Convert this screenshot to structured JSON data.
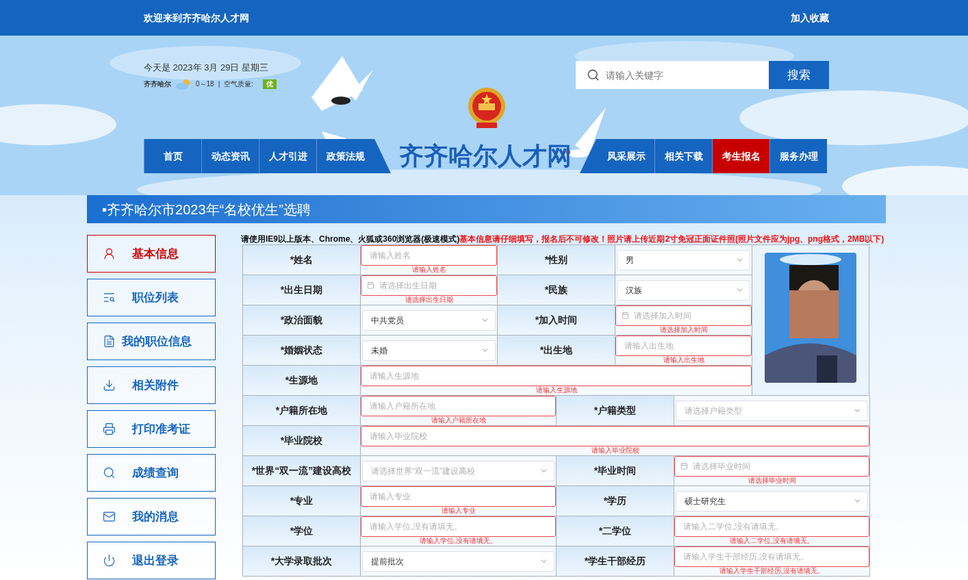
{
  "top_bar": {
    "welcome": "欢迎来到齐齐哈尔人才网",
    "favorite": "加入收藏"
  },
  "header": {
    "date": "今天是 2023年 3月 29日 星期三",
    "weather": {
      "city": "齐齐哈尔",
      "temperature": "0～18",
      "separator": "|",
      "air_quality_label": "空气质量:",
      "air_quality": "优"
    },
    "search": {
      "placeholder": "请输入关键字",
      "button": "搜索"
    },
    "site_title": "齐齐哈尔人才网",
    "nav_left": [
      {
        "label": "首页",
        "selected": false
      },
      {
        "label": "动态资讯",
        "selected": false
      },
      {
        "label": "人才引进",
        "selected": false
      },
      {
        "label": "政策法规",
        "selected": false
      }
    ],
    "nav_right": [
      {
        "label": "风采展示",
        "selected": false
      },
      {
        "label": "相关下载",
        "selected": false
      },
      {
        "label": "考生报名",
        "selected": true
      },
      {
        "label": "服务办理",
        "selected": false
      }
    ]
  },
  "banner": {
    "title": "▪齐齐哈尔市2023年“名校优生”选聘"
  },
  "notice": {
    "general": "请使用IE9以上版本、Chrome、火狐或360浏览器(极速模式)",
    "warning": "基本信息请仔细填写，报名后不可修改！照片请上传近期2寸免冠正面证件照(照片文件应为jpg、png格式，2MB以下)"
  },
  "sidebar": [
    {
      "label": "基本信息",
      "selected": true
    },
    {
      "label": "职位列表",
      "selected": false
    },
    {
      "label": "我的职位信息",
      "selected": false
    },
    {
      "label": "相关附件",
      "selected": false
    },
    {
      "label": "打印准考证",
      "selected": false
    },
    {
      "label": "成绩查询",
      "selected": false
    },
    {
      "label": "我的消息",
      "selected": false
    },
    {
      "label": "退出登录",
      "selected": false
    }
  ],
  "form": {
    "top_rows": [
      [
        {
          "label": "*姓名",
          "control": {
            "kind": "input",
            "placeholder": "请输入姓名",
            "error": "请输入姓名"
          }
        },
        {
          "label": "*性别",
          "control": {
            "kind": "select",
            "value": "男"
          }
        }
      ],
      [
        {
          "label": "*出生日期",
          "control": {
            "kind": "date",
            "placeholder": "请选择出生日期",
            "error": "请选择出生日期"
          }
        },
        {
          "label": "*民族",
          "control": {
            "kind": "select",
            "value": "汉族"
          }
        }
      ],
      [
        {
          "label": "*政治面貌",
          "control": {
            "kind": "select",
            "value": "中共党员"
          }
        },
        {
          "label": "*加入时间",
          "control": {
            "kind": "date",
            "placeholder": "请选择加入时间",
            "error": "请选择加入时间"
          }
        }
      ],
      [
        {
          "label": "*婚姻状态",
          "control": {
            "kind": "select",
            "value": "未婚"
          }
        },
        {
          "label": "*出生地",
          "control": {
            "kind": "input",
            "placeholder": "请输入出生地",
            "error": "请输入出生地"
          }
        }
      ],
      [
        {
          "label": "*生源地",
          "control": {
            "kind": "input",
            "placeholder": "请输入生源地",
            "error": "请输入生源地"
          }
        }
      ]
    ],
    "photo": {
      "kind": "picture"
    },
    "bottom_rows": [
      [
        {
          "label": "*户籍所在地",
          "control": {
            "kind": "input",
            "placeholder": "请输入户籍所在地",
            "error": "请输入户籍所在地"
          }
        },
        {
          "label": "*户籍类型",
          "control": {
            "kind": "select",
            "placeholder": "请选择户籍类型"
          }
        }
      ],
      [
        {
          "label": "*毕业院校",
          "control": {
            "kind": "input",
            "placeholder": "请输入毕业院校",
            "error": "请输入毕业院校"
          }
        }
      ],
      [
        {
          "label": "*世界“双一流”建设高校",
          "control": {
            "kind": "select",
            "placeholder": "请选择世界“双一流”建设高校"
          }
        },
        {
          "label": "*毕业时间",
          "control": {
            "kind": "date",
            "placeholder": "请选择毕业时间",
            "error": "请选择毕业时间"
          }
        }
      ],
      [
        {
          "label": "*专业",
          "control": {
            "kind": "input",
            "placeholder": "请输入专业",
            "error": "请输入专业"
          }
        },
        {
          "label": "*学历",
          "control": {
            "kind": "select",
            "value": "硕士研究生"
          }
        }
      ],
      [
        {
          "label": "*学位",
          "control": {
            "kind": "input",
            "placeholder": "请输入学位,没有请填无。",
            "error": "请输入学位,没有请填无。"
          }
        },
        {
          "label": "*二学位",
          "control": {
            "kind": "input",
            "placeholder": "请输入二学位,没有请填无。",
            "error": "请输入二学位,没有请填无。"
          }
        }
      ],
      [
        {
          "label": "*大学录取批次",
          "control": {
            "kind": "select",
            "value": "提前批次"
          }
        },
        {
          "label": "*学生干部经历",
          "control": {
            "kind": "input",
            "placeholder": "请输入学生干部经历,没有请填无。",
            "error": "请输入学生干部经历,没有请填无。"
          }
        }
      ]
    ]
  }
}
